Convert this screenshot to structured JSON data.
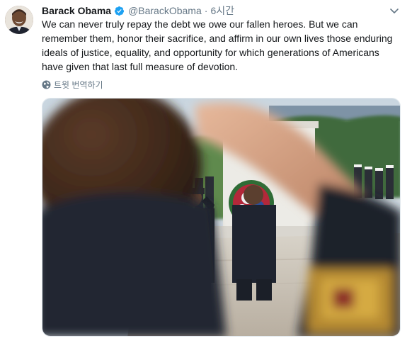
{
  "tweet": {
    "author": {
      "name": "Barack Obama",
      "handle": "@BarackObama",
      "verified": true,
      "avatar_icon": "profile-photo"
    },
    "separator": "·",
    "time": "6시간",
    "text": "We can never truly repay the debt we owe our fallen heroes. But we can remember them, honor their sacrifice, and affirm in our own lives those enduring ideals of justice, equality, and opportunity for which generations of Americans have given that last full measure of devotion.",
    "translate_label": "트윗 번역하기",
    "media_icon": "photo-saluting-soldier-wreath-ceremony"
  },
  "colors": {
    "text": "#14171a",
    "secondary": "#657786",
    "verified": "#1da1f2",
    "border": "#e1e8ed"
  }
}
